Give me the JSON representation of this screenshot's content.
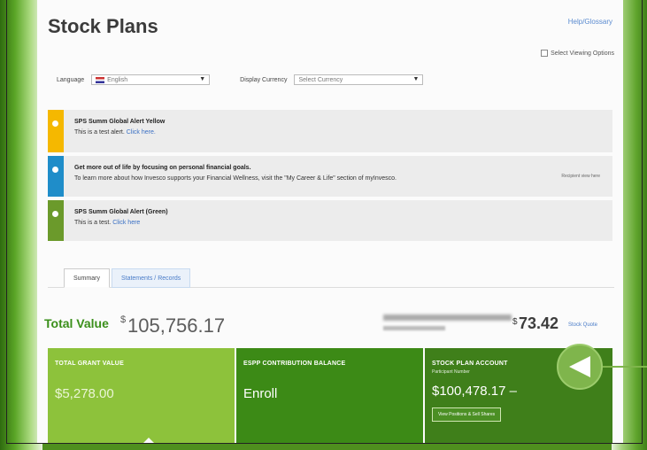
{
  "header": {
    "title": "Stock Plans",
    "help_link": "Help/Glossary",
    "viewing_options": "Select Viewing Options"
  },
  "selectors": {
    "language_label": "Language",
    "language_value": "English",
    "currency_label": "Display Currency",
    "currency_value": "Select Currency"
  },
  "alerts": [
    {
      "title": "SPS Summ Global Alert Yellow",
      "text": "This is a test alert.",
      "link": "Click here.",
      "color": "#f5b800"
    },
    {
      "title": "Get more out of life by focusing on personal financial goals.",
      "text": "To learn more about how Invesco supports your Financial Wellness, visit the \"My Career & Life\" section of myInvesco.",
      "side": "Recipient view here",
      "color": "#1f8dc9"
    },
    {
      "title": "SPS Summ Global Alert (Green)",
      "text": "This is a test.",
      "link": "Click here",
      "color": "#6b9a2b"
    }
  ],
  "tabs": [
    "Summary",
    "Statements / Records"
  ],
  "summary": {
    "total_label": "Total Value",
    "total_currency": "$",
    "total_value": "105,756.17",
    "ticker_currency": "$",
    "ticker_price": "73.42",
    "quote_link": "Stock Quote"
  },
  "tiles": [
    {
      "title": "TOTAL GRANT VALUE",
      "value": "$5,278.00"
    },
    {
      "title": "ESPP CONTRIBUTION BALANCE",
      "value": "Enroll"
    },
    {
      "title": "STOCK PLAN ACCOUNT",
      "subtitle": "Participant Number",
      "value": "$100,478.17 –",
      "button": "View Positions & Sell Shares"
    }
  ],
  "icons": {
    "play": "play-icon",
    "checkbox": "checkbox-icon"
  }
}
